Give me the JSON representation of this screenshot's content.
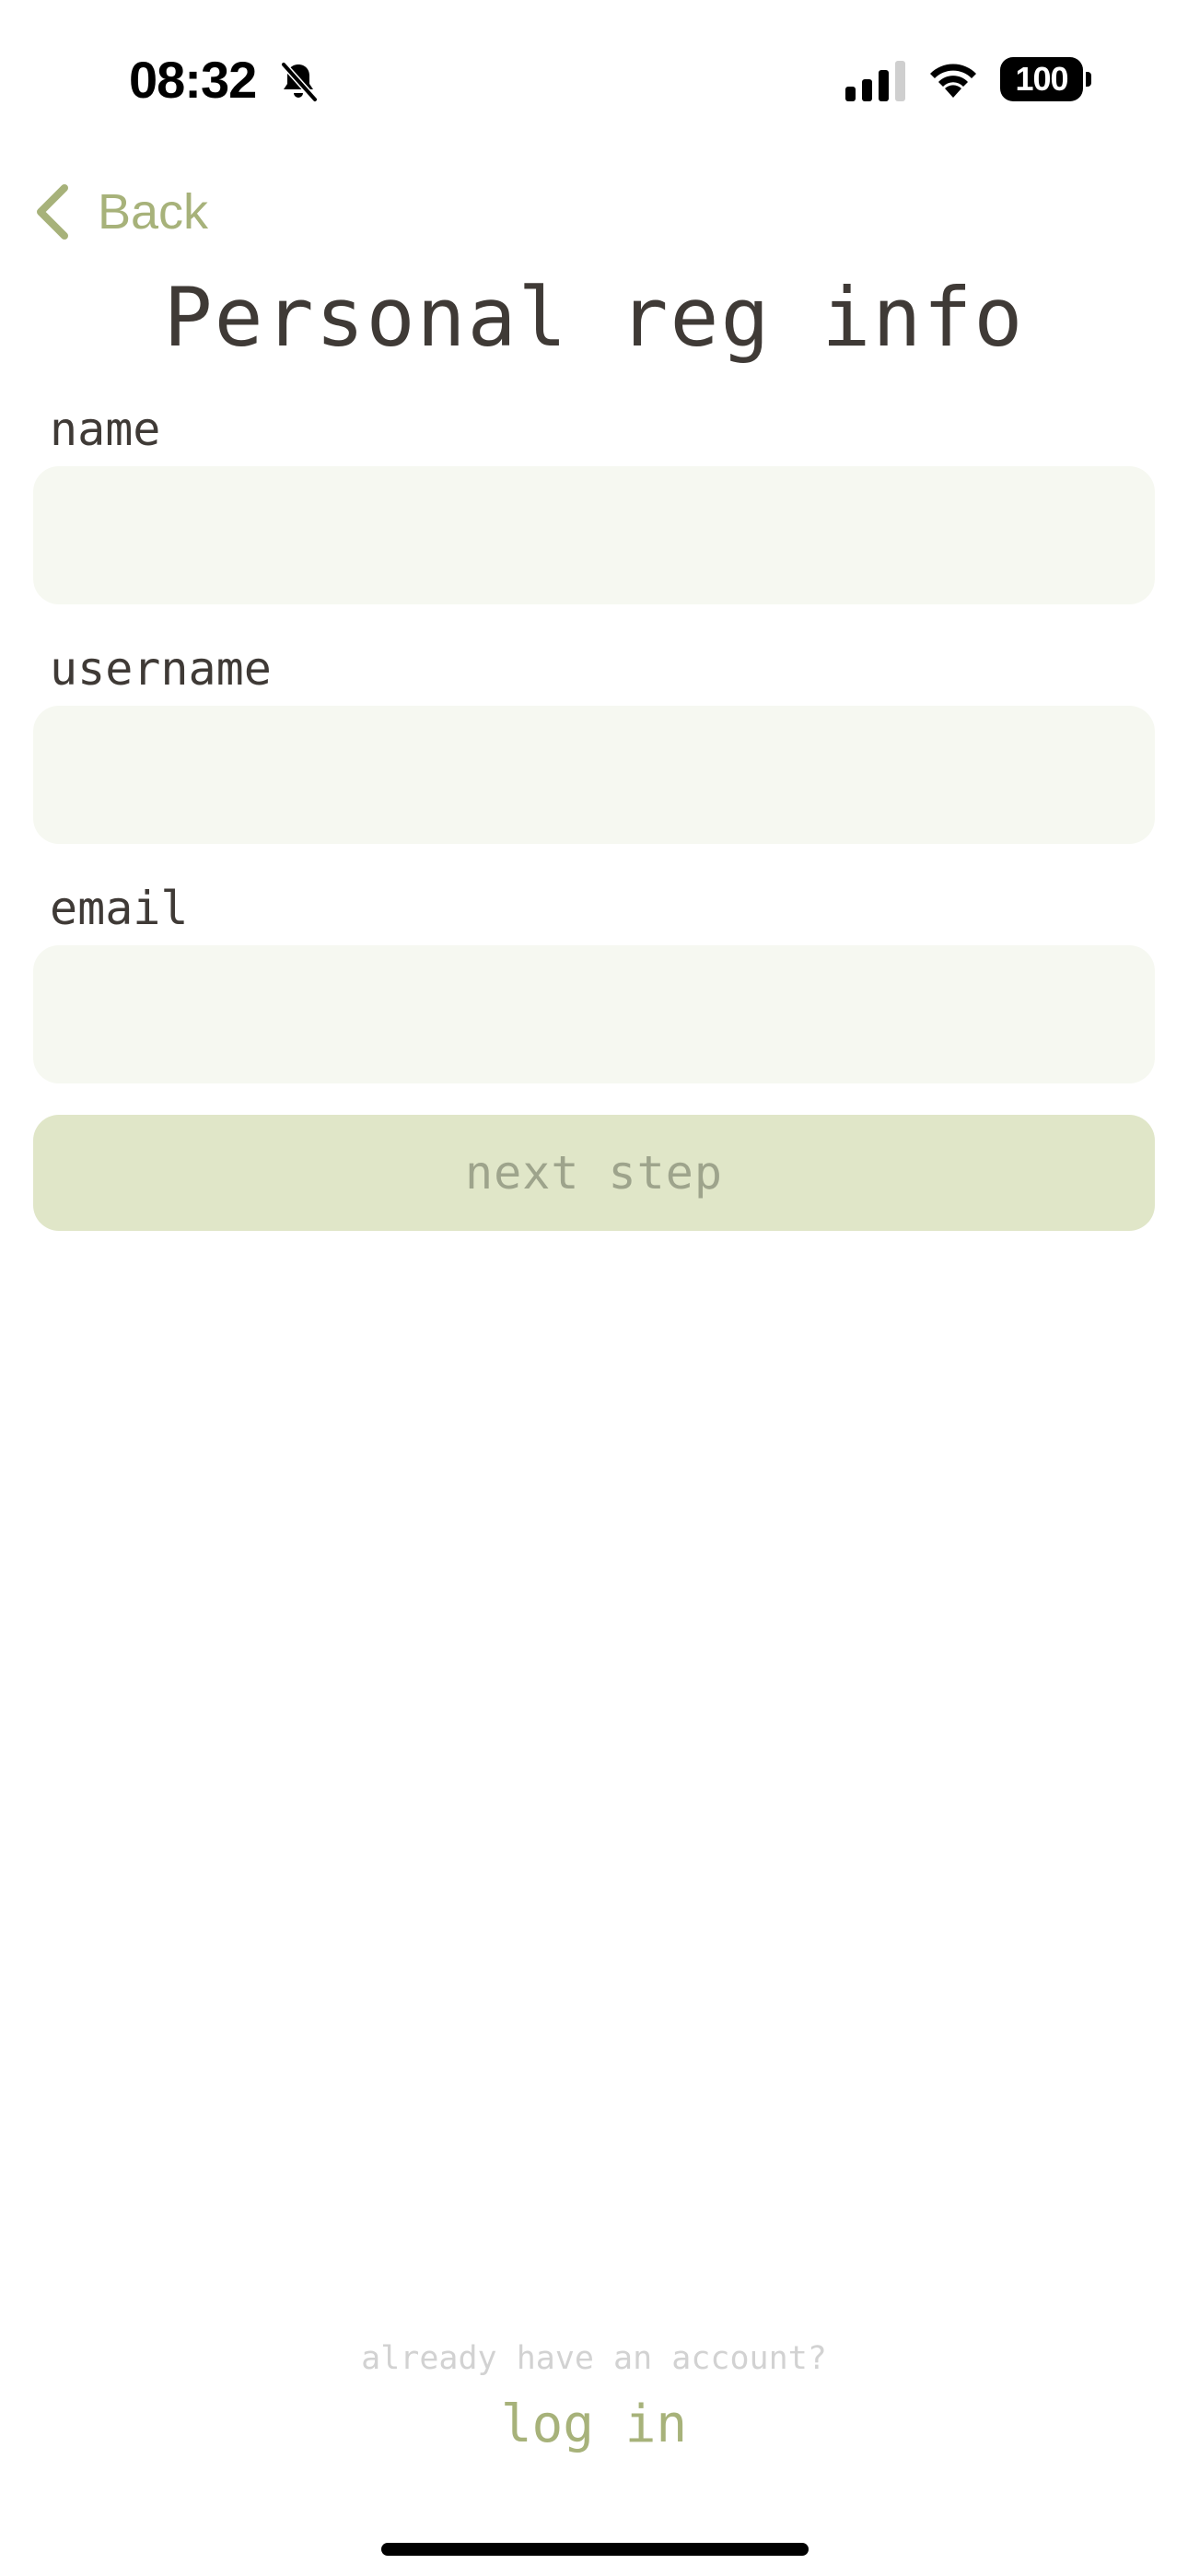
{
  "status_bar": {
    "time": "08:32",
    "battery_level": "100",
    "icons": [
      "bell-slash-icon",
      "cellular-signal-icon",
      "wifi-icon",
      "battery-icon"
    ]
  },
  "nav": {
    "back_label": "Back"
  },
  "page": {
    "title": "Personal reg info"
  },
  "form": {
    "fields": [
      {
        "label": "name",
        "value": "",
        "placeholder": ""
      },
      {
        "label": "username",
        "value": "",
        "placeholder": ""
      },
      {
        "label": "email",
        "value": "",
        "placeholder": ""
      }
    ],
    "next_button_label": "next step"
  },
  "footer": {
    "prompt": "already have an account?",
    "login_label": "log in"
  },
  "colors": {
    "accent": "#a7b27a",
    "text": "#3f3a36",
    "input_bg": "#f6f8f1",
    "button_bg": "#e0e6c8",
    "button_text": "#9ea48c",
    "muted": "#d2d2d2"
  }
}
